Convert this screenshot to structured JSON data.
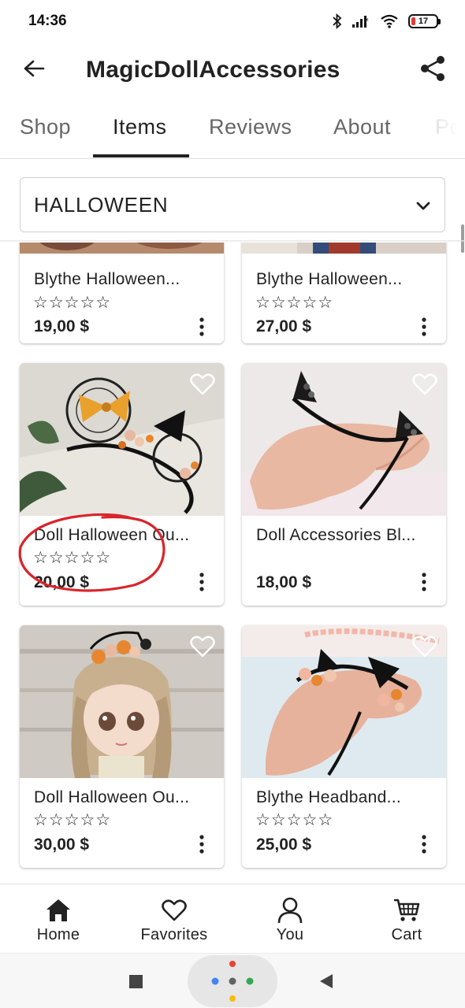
{
  "status_bar": {
    "time": "14:36",
    "battery": "17"
  },
  "app_bar": {
    "title": "MagicDollAccessories"
  },
  "tabs": [
    {
      "label": "Shop",
      "active": false
    },
    {
      "label": "Items",
      "active": true
    },
    {
      "label": "Reviews",
      "active": false
    },
    {
      "label": "About",
      "active": false
    },
    {
      "label": "Po",
      "active": false
    }
  ],
  "filter": {
    "selected": "HALLOWEEN"
  },
  "products": [
    {
      "title": "Blythe Halloween...",
      "stars": "☆☆☆☆☆",
      "price": "19,00 $"
    },
    {
      "title": "Blythe Halloween...",
      "stars": "☆☆☆☆☆",
      "price": "27,00 $"
    },
    {
      "title": "Doll Halloween Ou...",
      "stars": "☆☆☆☆☆",
      "price": "20,00 $"
    },
    {
      "title": "Doll Accessories Bl...",
      "stars": "",
      "price": "18,00 $"
    },
    {
      "title": "Doll Halloween Ou...",
      "stars": "☆☆☆☆☆",
      "price": "30,00 $"
    },
    {
      "title": "Blythe Headband...",
      "stars": "☆☆☆☆☆",
      "price": "25,00 $"
    }
  ],
  "bottom_nav": [
    {
      "label": "Home",
      "icon": "home-icon",
      "active": true
    },
    {
      "label": "Favorites",
      "icon": "heart-icon",
      "active": false
    },
    {
      "label": "You",
      "icon": "person-icon",
      "active": false
    },
    {
      "label": "Cart",
      "icon": "cart-icon",
      "active": false
    }
  ],
  "colors": {
    "annotation": "#d9252a",
    "text": "#222222",
    "divider": "#dddddd"
  }
}
